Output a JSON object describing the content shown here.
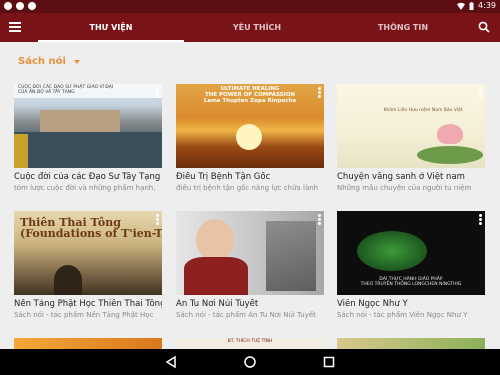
{
  "status": {
    "time": "4:39"
  },
  "tabs": [
    {
      "label": "THƯ VIỆN",
      "active": true
    },
    {
      "label": "YÊU THÍCH",
      "active": false
    },
    {
      "label": "THÔNG TIN",
      "active": false
    }
  ],
  "filter": {
    "label": "Sách nói"
  },
  "colors": {
    "appbar": "#7a1318",
    "statusbar": "#5d0e12",
    "accent": "#e7903a"
  },
  "cards": [
    {
      "title": "Cuộc đời của các Đạo Sư Tây Tạng",
      "subtitle": "tóm lược cuộc đời và những phẩm hạnh,",
      "thumb_text": "CUỘC ĐỜI CÁC ĐẠO SƯ PHẬT GIÁO VĨ ĐẠI\nCỦA ẤN ĐỘ VÀ TÂY TẠNG"
    },
    {
      "title": "Điều Trị Bệnh Tận Gốc",
      "subtitle": "điều trị bệnh tận gốc năng lực chữa lành",
      "thumb_text": "ULTIMATE HEALING\nTHE POWER OF COMPASSION\nLama Thupten Zopa Rinpoche"
    },
    {
      "title": "Chuyện văng sanh ở Việt nam",
      "subtitle": "Những mẫu chuyện của người tu niệm",
      "thumb_text": "Khâm Liên Hựu niệm Nam Bảo Việt"
    },
    {
      "title": "Nền Tảng Phật Học Thiên Thai Tông",
      "subtitle": "Sách nói - tác phẩm Nền Tảng Phật Học",
      "thumb_text": "Thiên Thai Tông\n(Foundations of T'ien-T'ai Philosophy)"
    },
    {
      "title": "Ẩn Tu Nơi Núi Tuyết",
      "subtitle": "Sách nói - tác phẩm Ẩn Tu Nơi Núi Tuyết",
      "thumb_text": ""
    },
    {
      "title": "Viên Ngọc Như Ý",
      "subtitle": "Sách nói - tác phẩm Viên Ngọc Như Ý",
      "thumb_text": "ĐẠI THỰC HÀNH GIÁO PHÁP\nTHEO TRUYỀN THỐNG LONGCHEN NINGTHIG"
    }
  ],
  "peek_texts": [
    "BT. THÍCH TUỆ TĨNH"
  ]
}
